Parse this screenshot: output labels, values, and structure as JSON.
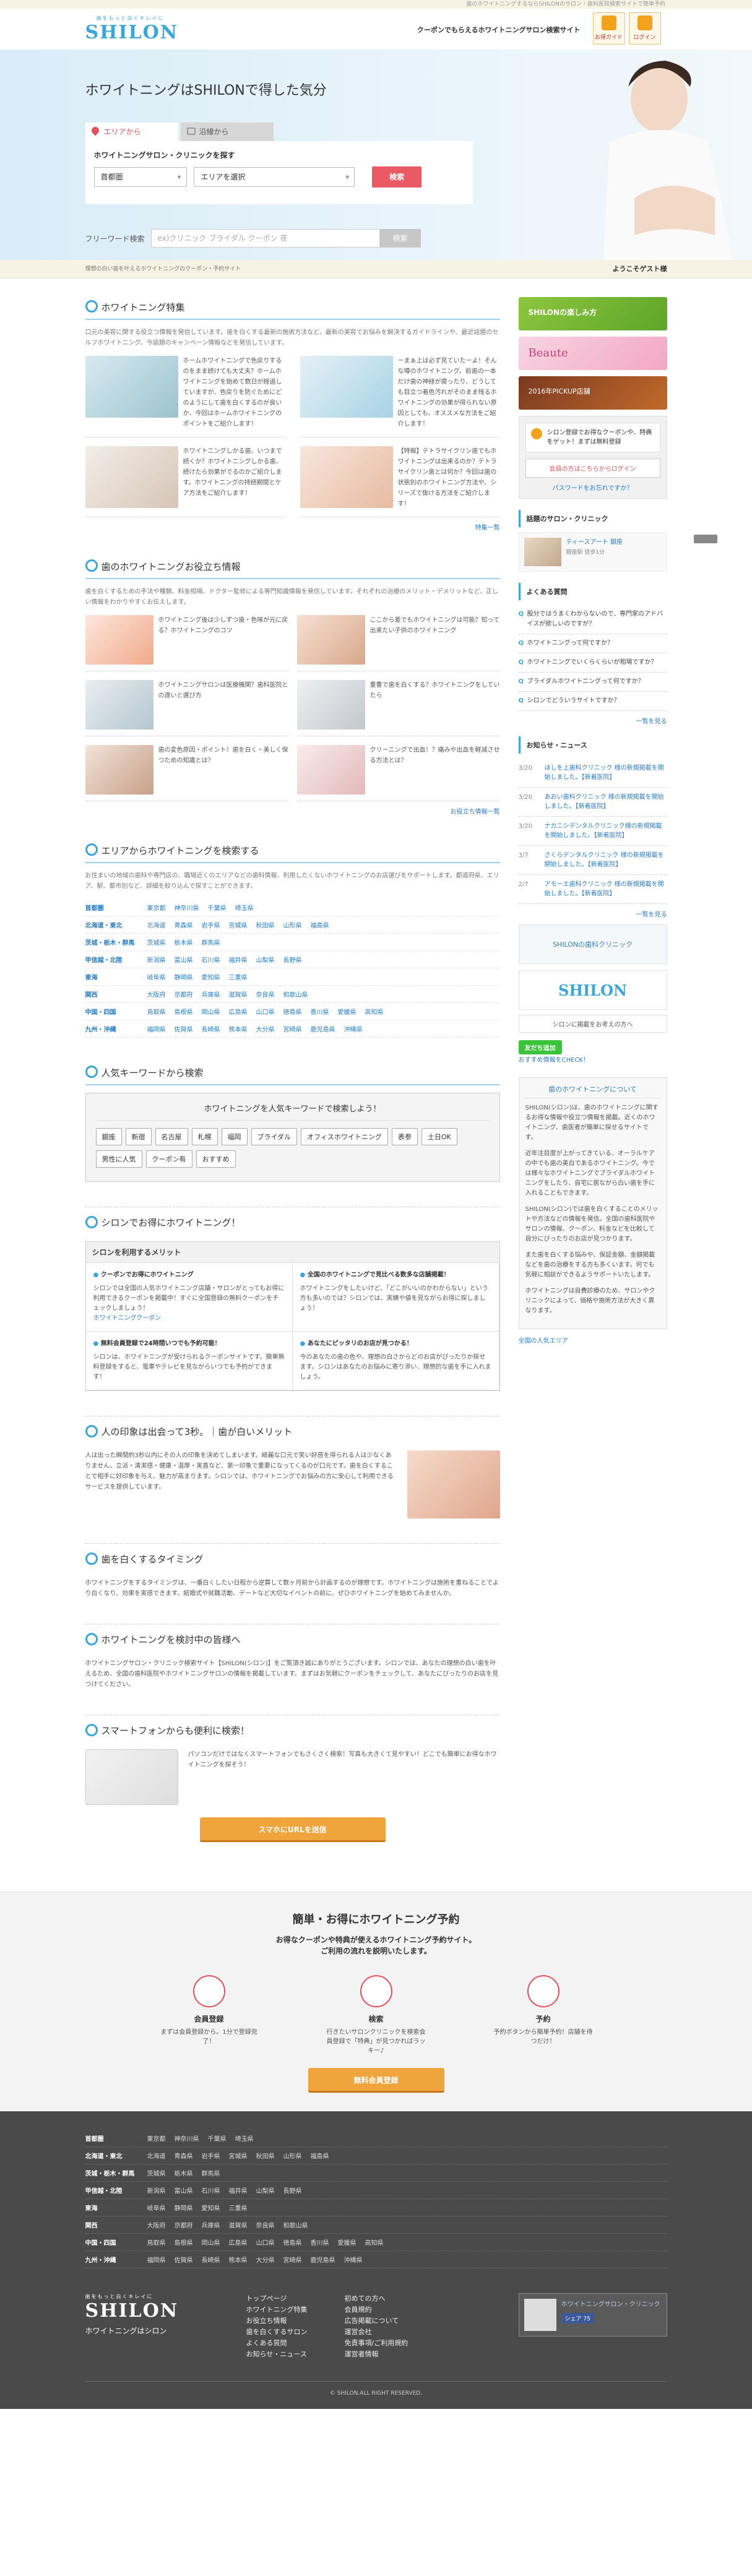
{
  "topbar": {
    "text": "歯のホワイトニングするならSHILONのサロン・歯科医院検索サイトで簡単予約"
  },
  "header": {
    "logo_ja": "歯をもっと白くキレイに",
    "logo_en": "SHILON",
    "catch": "クーポンでもらえるホワイトニングサロン検索サイト",
    "btn_guide": "お得ガイド",
    "btn_login": "ログイン"
  },
  "hero": {
    "title": "ホワイトニングはSHILONで得した気分",
    "tab_area": "エリアから",
    "tab_route": "沿線から",
    "search_title": "ホワイトニングサロン・クリニックを探す",
    "select_pref": "首都圏",
    "select_area": "エリアを選択",
    "search_btn": "検索",
    "freeword_label": "フリーワード検索",
    "freeword_placeholder": "ex)クリニック ブライダル クーポン 夜",
    "freeword_btn": "検索"
  },
  "breadcrumb": {
    "text": "理想の白い歯を叶えるホワイトニングのクーポン・予約サイト",
    "guest": "ようこそゲスト様"
  },
  "feature": {
    "title": "ホワイトニング特集",
    "lead": "口元の美容に関する役立つ情報を発信しています。歯を白くする最新の施術方法など、最新の美容でお悩みを解決するガイドラインや、最近話題のセルフホワイトニング、今話題のキャンペーン情報などを発信しています。",
    "items": [
      {
        "text": "ホームホワイトニングで色戻りするのをまま続けても大丈夫？ホームホワイトニングを始めて数日が経過していますが、色戻りを防ぐためにどのようにして歯を白くするのが良いか、今回はホームホワイトニングのポイントをご紹介します！"
      },
      {
        "text": "ーまぁ上は必ず見ていたーよ！そんな噂のホワイトニング。前歯の一本だけ歯の神経が腐ったり、どうしても目立つ着色汚れがそのまま残るホワイトニングの効果が得られない原因としても、オススメな方法をご紹介します！"
      },
      {
        "text": "ホワイトニングしかる歯、いつまで続くか？ホワイトニングしかる歯、続けたら効果がでるのかご紹介します。ホワイトニングの持続期間とケア方法をご紹介します！"
      },
      {
        "text": "【特報】テトラサイクリン歯でもホワイトニングは出来るのか？テトラサイクリン歯とは何か？今回は歯の状態別のホワイトニング方法や、シリーズで抜ける方法をご紹介します！"
      }
    ],
    "more": "特集一覧"
  },
  "tips": {
    "title": "歯のホワイトニングお役立ち情報",
    "lead": "歯を白くするための手法や種類、料金相場、ドクター監修による専門知識情報を発信しています。それぞれの治療のメリット・デメリットなど、正しい情報をわかりやすくお伝えします。",
    "items": [
      {
        "text": "ホワイトニング後は少しずつ歯・色味が元に戻る？ホワイトニングのコツ"
      },
      {
        "text": "ここから差でもホワイトニングは可能？知って出来たい子供のホワイトニング"
      },
      {
        "text": "ホワイトニングサロンは医療機関？歯科医院との違いと選び方"
      },
      {
        "text": "重曹で歯を白くする？ホワイトニングをしていたら"
      },
      {
        "text": "歯の変色原因・ポイント！歯を白く・美しく保つための知識とは？"
      },
      {
        "text": "クリーニングで出血！？痛みや出血を軽減させる方法とは？"
      }
    ],
    "more": "お役立ち情報一覧"
  },
  "area_search": {
    "title": "エリアからホワイトニングを検索する",
    "lead": "お住まいの地域の歯科や専門店の、職場近くのエリアなどの歯科情報、利用したくないホワイトニングのお店選びをサポートします。都道府県、エリア、駅、都市別など、詳細を絞り込んで探すことができます。",
    "rows": [
      {
        "region": "首都圏",
        "prefs": [
          "東京都",
          "神奈川県",
          "千葉県",
          "埼玉県"
        ]
      },
      {
        "region": "北海道・東北",
        "prefs": [
          "北海道",
          "青森県",
          "岩手県",
          "宮城県",
          "秋田県",
          "山形県",
          "福島県"
        ]
      },
      {
        "region": "茨城・栃木・群馬",
        "prefs": [
          "茨城県",
          "栃木県",
          "群馬県"
        ]
      },
      {
        "region": "甲信越・北陸",
        "prefs": [
          "新潟県",
          "富山県",
          "石川県",
          "福井県",
          "山梨県",
          "長野県"
        ]
      },
      {
        "region": "東海",
        "prefs": [
          "岐阜県",
          "静岡県",
          "愛知県",
          "三重県"
        ]
      },
      {
        "region": "関西",
        "prefs": [
          "大阪府",
          "京都府",
          "兵庫県",
          "滋賀県",
          "奈良県",
          "和歌山県"
        ]
      },
      {
        "region": "中国・四国",
        "prefs": [
          "鳥取県",
          "島根県",
          "岡山県",
          "広島県",
          "山口県",
          "徳島県",
          "香川県",
          "愛媛県",
          "高知県"
        ]
      },
      {
        "region": "九州・沖縄",
        "prefs": [
          "福岡県",
          "佐賀県",
          "長崎県",
          "熊本県",
          "大分県",
          "宮崎県",
          "鹿児島県",
          "沖縄県"
        ]
      }
    ]
  },
  "keywords": {
    "title": "人気キーワードから検索",
    "box_title": "ホワイトニングを人気キーワードで検索しよう！",
    "items": [
      "銀座",
      "新宿",
      "名古屋",
      "札幌",
      "福岡",
      "ブライダル",
      "オフィスホワイトニング",
      "表参",
      "土日OK",
      "男性に人気",
      "クーポン有",
      "おすすめ"
    ]
  },
  "benefit": {
    "title": "シロンでお得にホワイトニング！",
    "box_title": "シロンを利用するメリット",
    "cells": [
      {
        "h": "クーポンでお得にホワイトニング",
        "t": "シロンでは全国の人気ホワイトニング店舗・サロンがとってもお得に利用できるクーポンを掲載中！すぐに全国登録の無料クーポンをチェックしましょう！"
      },
      {
        "h": "全国のホワイトニングで見比べる数多な店舗掲載！",
        "t": "ホワイトニングをしたいけど、「どこがいいのかわからない」という方も多いのでは？シロンでは、実績や値を見ながらお得に探しましょう！"
      },
      {
        "h": "無料会員登録で24時間いつでも予約可能！",
        "t": "シロンは、ホワイトニングが受けられるクーポンサイトです。簡単無料登録をすると、電車やテレビを見ながらいつでも予約ができます！"
      },
      {
        "h": "あなたにピッタリのお店が見つかる！",
        "t": "今のあなたの歯の色や、理想の白さからどのお店がぴったりか探せます。シロンはあなたのお悩みに寄り添い、理想的な歯を手に入れましょう。"
      }
    ],
    "coupon_link": "ホワイトニングクーポン"
  },
  "smile": {
    "title": "人の印象は出会って3秒。｜歯が白いメリット",
    "text": "人は出った瞬間約3秒以内にその人の印象を決めてしまいます。綺麗な口元で笑い好感を得られる人は少なくありません。立派・清潔感・健康・温厚・実直など、第一印象で重要になってくるのが口元です。歯を白くすることで相手に好印象を与え、魅力が高まります。シロンでは、ホワイトニングでお悩みの方に安心して利用できるサービスを提供しています。"
  },
  "timing": {
    "title": "歯を白くするタイミング",
    "text": "ホワイトニングをするタイミングは、一番白くしたい日程から逆算して数ヶ月前から計画するのが理想です。ホワイトニングは施術を重ねることでより白くなり、効果を実感できます。結婚式や就職活動、デートなど大切なイベントの前に、ぜひホワイトニングを始めてみませんか。"
  },
  "consider": {
    "title": "ホワイトニングを検討中の皆様へ",
    "text": "ホワイトニングサロン・クリニック検索サイト【SHILON(シロン)】をご覧頂き誠にありがとうございます。シロンでは、あなたの理想の白い歯を叶えるため、全国の歯科医院やホワイトニングサロンの情報を掲載しています。まずはお気軽にクーポンをチェックして、あなたにぴったりのお店を見つけてください。"
  },
  "smartphone": {
    "title": "スマートフォンからも便利に検索！",
    "text": "パソコンだけではなくスマートフォンでもさくさく検索！写真も大きくて見やすい！どこでも簡単にお得なホワイトニングを探そう！",
    "btn": "スマホにURLを送信"
  },
  "register": {
    "title": "簡単・お得にホワイトニング予約",
    "sub1": "お得なクーポンや特典が使えるホワイトニング予約サイト。",
    "sub2": "ご利用の流れを説明いたします。",
    "steps": [
      {
        "h": "会員登録",
        "t": "まずは会員登録から。1分で登録完了！"
      },
      {
        "h": "検索",
        "t": "行きたいサロンクリニックを検索会員登録で「特典」が見つかればラッキー♪"
      },
      {
        "h": "予約",
        "t": "予約ボタンから簡単予約！店舗を待つだけ！"
      }
    ],
    "btn": "無料会員登録"
  },
  "side": {
    "banner1": "SHILONの楽しみ方",
    "banner2": "Beaute",
    "banner3": "2016年PICKUP店舗",
    "alert": "シロン登録でお得なクーポンや、特典をゲット！まずは無料登録",
    "login_btn": "会員の方はこちらからログイン",
    "forgot": "パスワードをお忘れですか？",
    "popular_h": "話題のサロン・クリニック",
    "popular_name": "ティースアート 銀座",
    "popular_area": "銀座駅 徒歩1分",
    "faq_h": "よくある質問",
    "faq": [
      "股分ではうまくわからないので、専門家のアドバイスが欲しいのですが？",
      "ホワイトニングって何ですか？",
      "ホワイトニングでいくらくらいが相場ですか？",
      "ブライダルホワイトニングって何ですか？",
      "シロンでどういうサイトですか？"
    ],
    "faq_more": "一覧を見る",
    "news_h": "お知らせ・ニュース",
    "news": [
      {
        "d": "3/20",
        "t": "ほしを上歯科クリニック 様の新規掲載を開始しました。【新着医院】"
      },
      {
        "d": "3/20",
        "t": "あおい歯科クリニック 様の新規掲載を開始しました。【新着医院】"
      },
      {
        "d": "3/20",
        "t": "ナカニシデンタルクリニック様の新規掲載を開始しました。【新着医院】"
      },
      {
        "d": "3/7",
        "t": "さくらデンタルクリニック 様の新規掲載を開始しました。【新着医院】"
      },
      {
        "d": "2/7",
        "t": "アモーエ歯科クリニック 様の新規掲載を開始しました。【新着医院】"
      }
    ],
    "news_more": "一覧を見る",
    "ad1": "SHILONの歯科クリニック",
    "ad2": "SHILON",
    "ad3": "シロンに掲載をお考えの方へ",
    "line": "友だち追加",
    "line_link": "おすすめ情報をCHECK！",
    "about_h": "歯のホワイトニングについて",
    "about": [
      "SHILON(シロン)は、歯のホワイトニングに関するお得な情報や役立つ情報を掲載。近くのホワイトニング、歯医者が簡単に探せるサイトです。",
      "近年注目度が上がってきている、オーラルケアの中でも歯の美白であるホワイトニング。今では様々なホワイトニングでブライダルホワイトニングをしたり、自宅に居ながら白い歯を手に入れることもできます。",
      "SHILON(シロン)では歯を白くすることのメリットや方法などの情報を発信。全国の歯科医院やサロンの情報、クーポン、料金などを比較して自分にぴったりのお店が見つかります。",
      "また歯を白くする悩みや、保証金額、金額掲載などを歯の治療をする方も多くいます。何でも気軽に相談ができるようサポートいたします。",
      "ホワイトニングは自費診療のため、サロンやクリニックによって、価格や施術方法が大きく異なります。"
    ],
    "about_link": "全国の人気エリア"
  },
  "footer": {
    "rows": [
      {
        "region": "首都圏",
        "prefs": [
          "東京都",
          "神奈川県",
          "千葉県",
          "埼玉県"
        ]
      },
      {
        "region": "北海道・東北",
        "prefs": [
          "北海道",
          "青森県",
          "岩手県",
          "宮城県",
          "秋田県",
          "山形県",
          "福島県"
        ]
      },
      {
        "region": "茨城・栃木・群馬",
        "prefs": [
          "茨城県",
          "栃木県",
          "群馬県"
        ]
      },
      {
        "region": "甲信越・北陸",
        "prefs": [
          "新潟県",
          "富山県",
          "石川県",
          "福井県",
          "山梨県",
          "長野県"
        ]
      },
      {
        "region": "東海",
        "prefs": [
          "岐阜県",
          "静岡県",
          "愛知県",
          "三重県"
        ]
      },
      {
        "region": "関西",
        "prefs": [
          "大阪府",
          "京都府",
          "兵庫県",
          "滋賀県",
          "奈良県",
          "和歌山県"
        ]
      },
      {
        "region": "中国・四国",
        "prefs": [
          "鳥取県",
          "島根県",
          "岡山県",
          "広島県",
          "山口県",
          "徳島県",
          "香川県",
          "愛媛県",
          "高知県"
        ]
      },
      {
        "region": "九州・沖縄",
        "prefs": [
          "福岡県",
          "佐賀県",
          "長崎県",
          "熊本県",
          "大分県",
          "宮崎県",
          "鹿児島県",
          "沖縄県"
        ]
      }
    ],
    "logo": "SHILON",
    "logo_ja": "歯をもっと白くキレイに",
    "logo_sub": "ホワイトニングはシロン",
    "col1": [
      "トップページ",
      "ホワイトニング特集",
      "お役立ち情報",
      "歯を白くするサロン",
      "よくある質問",
      "お知らせ・ニュース"
    ],
    "col2": [
      "初めての方へ",
      "会員規約",
      "広告掲載について",
      "運営会社",
      "免責事項/ご利用規約",
      "運営者情報"
    ],
    "banner": "ホワイトニングサロン・クリニック",
    "share": "シェア 75",
    "copyright": "© SHILON.ALL RIGHT RESERVED."
  },
  "colors": {
    "accent": "#3aa6d9",
    "red": "#ea5a64",
    "orange": "#f0a43c"
  }
}
